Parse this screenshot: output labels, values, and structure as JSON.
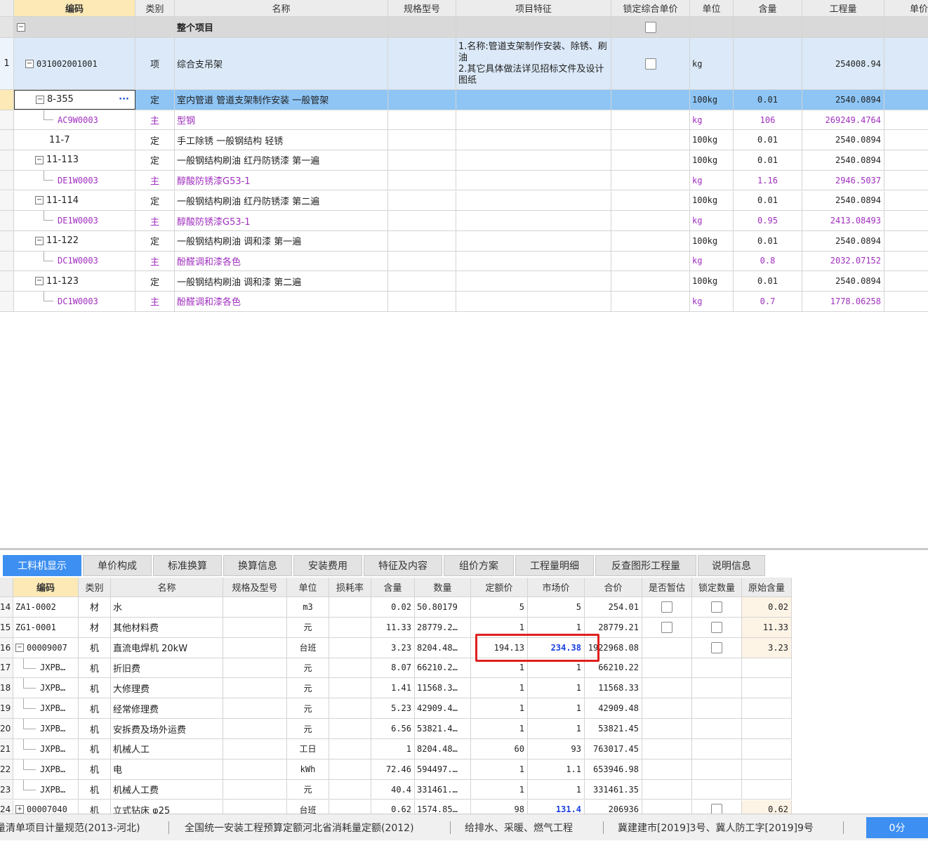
{
  "top_headers": [
    "编码",
    "类别",
    "名称",
    "规格型号",
    "项目特征",
    "锁定综合单价",
    "单位",
    "含量",
    "工程量",
    "单价"
  ],
  "whole_label": "整个项目",
  "item": {
    "rownum": "1",
    "code": "031002001001",
    "type": "项",
    "name": "综合支吊架",
    "feature": "1.名称:管道支架制作安装、除锈、刷油\n2.其它具体做法详见招标文件及设计图纸",
    "unit": "kg",
    "qty": "254008.94"
  },
  "sub_rows": [
    {
      "code": "8-355",
      "type": "定",
      "name": "室内管道 管道支架制作安装 一般管架",
      "unit": "100kg",
      "content": "0.01",
      "qty": "2540.0894"
    },
    {
      "code": "AC9W0003",
      "type": "主",
      "name": "型钢",
      "unit": "kg",
      "content": "106",
      "qty": "269249.4764"
    },
    {
      "code": "11-7",
      "type": "定",
      "name": "手工除锈 一般钢结构 轻锈",
      "unit": "100kg",
      "content": "0.01",
      "qty": "2540.0894"
    },
    {
      "code": "11-113",
      "type": "定",
      "name": "一般钢结构刷油 红丹防锈漆 第一遍",
      "unit": "100kg",
      "content": "0.01",
      "qty": "2540.0894"
    },
    {
      "code": "DE1W0003",
      "type": "主",
      "name": "醇酸防锈漆G53-1",
      "unit": "kg",
      "content": "1.16",
      "qty": "2946.5037"
    },
    {
      "code": "11-114",
      "type": "定",
      "name": "一般钢结构刷油 红丹防锈漆 第二遍",
      "unit": "100kg",
      "content": "0.01",
      "qty": "2540.0894"
    },
    {
      "code": "DE1W0003",
      "type": "主",
      "name": "醇酸防锈漆G53-1",
      "unit": "kg",
      "content": "0.95",
      "qty": "2413.08493"
    },
    {
      "code": "11-122",
      "type": "定",
      "name": "一般钢结构刷油 调和漆 第一遍",
      "unit": "100kg",
      "content": "0.01",
      "qty": "2540.0894"
    },
    {
      "code": "DC1W0003",
      "type": "主",
      "name": "酚醛调和漆各色",
      "unit": "kg",
      "content": "0.8",
      "qty": "2032.07152"
    },
    {
      "code": "11-123",
      "type": "定",
      "name": "一般钢结构刷油 调和漆 第二遍",
      "unit": "100kg",
      "content": "0.01",
      "qty": "2540.0894"
    },
    {
      "code": "DC1W0003",
      "type": "主",
      "name": "酚醛调和漆各色",
      "unit": "kg",
      "content": "0.7",
      "qty": "1778.06258"
    }
  ],
  "tabs": [
    "工料机显示",
    "单价构成",
    "标准换算",
    "换算信息",
    "安装费用",
    "特征及内容",
    "组价方案",
    "工程量明细",
    "反查图形工程量",
    "说明信息"
  ],
  "bottom_headers": [
    "编码",
    "类别",
    "名称",
    "规格及型号",
    "单位",
    "损耗率",
    "含量",
    "数量",
    "定额价",
    "市场价",
    "合价",
    "是否暂估",
    "锁定数量",
    "原始含量"
  ],
  "bottom_rows": [
    {
      "n": "14",
      "code": "ZA1-0002",
      "type": "材",
      "name": "水",
      "unit": "m3",
      "content": "0.02",
      "num": "50.80179",
      "quota": "5",
      "market": "5",
      "total": "254.01",
      "orig": "0.02"
    },
    {
      "n": "15",
      "code": "ZG1-0001",
      "type": "材",
      "name": "其他材料费",
      "unit": "元",
      "content": "11.33",
      "num": "28779.2…",
      "quota": "1",
      "market": "1",
      "total": "28779.21",
      "orig": "11.33"
    },
    {
      "n": "16",
      "code": "00009007",
      "type": "机",
      "name": "直流电焊机 20kW",
      "unit": "台班",
      "content": "3.23",
      "num": "8204.48…",
      "quota": "194.13",
      "market": "234.38",
      "total": "1922968.08",
      "orig": "3.23"
    },
    {
      "n": "17",
      "code": "JXPB…",
      "type": "机",
      "name": "折旧费",
      "unit": "元",
      "content": "8.07",
      "num": "66210.2…",
      "quota": "1",
      "market": "1",
      "total": "66210.22",
      "orig": ""
    },
    {
      "n": "18",
      "code": "JXPB…",
      "type": "机",
      "name": "大修理费",
      "unit": "元",
      "content": "1.41",
      "num": "11568.3…",
      "quota": "1",
      "market": "1",
      "total": "11568.33",
      "orig": ""
    },
    {
      "n": "19",
      "code": "JXPB…",
      "type": "机",
      "name": "经常修理费",
      "unit": "元",
      "content": "5.23",
      "num": "42909.4…",
      "quota": "1",
      "market": "1",
      "total": "42909.48",
      "orig": ""
    },
    {
      "n": "20",
      "code": "JXPB…",
      "type": "机",
      "name": "安拆费及场外运费",
      "unit": "元",
      "content": "6.56",
      "num": "53821.4…",
      "quota": "1",
      "market": "1",
      "total": "53821.45",
      "orig": ""
    },
    {
      "n": "21",
      "code": "JXPB…",
      "type": "机",
      "name": "机械人工",
      "unit": "工日",
      "content": "1",
      "num": "8204.48…",
      "quota": "60",
      "market": "93",
      "total": "763017.45",
      "orig": ""
    },
    {
      "n": "22",
      "code": "JXPB…",
      "type": "机",
      "name": "电",
      "unit": "kWh",
      "content": "72.46",
      "num": "594497.…",
      "quota": "1",
      "market": "1.1",
      "total": "653946.98",
      "orig": ""
    },
    {
      "n": "23",
      "code": "JXPB…",
      "type": "机",
      "name": "机械人工费",
      "unit": "元",
      "content": "40.4",
      "num": "331461.…",
      "quota": "1",
      "market": "1",
      "total": "331461.35",
      "orig": ""
    },
    {
      "n": "24",
      "code": "00007040",
      "type": "机",
      "name": "立式钻床 φ25",
      "unit": "台班",
      "content": "0.62",
      "num": "1574.85…",
      "quota": "98",
      "market": "131.4",
      "total": "206936",
      "orig": "0.62"
    }
  ],
  "status": [
    "量清单项目计量规范(2013-河北)",
    "全国统一安装工程预算定额河北省消耗量定额(2012)",
    "给排水、采暖、燃气工程",
    "冀建建市[2019]3号、冀人防工字[2019]9号"
  ],
  "score": "0分",
  "colors": {
    "selected_row": "#8ec5f5",
    "item_row": "#dbe9f8",
    "whole_row": "#d9d9d9",
    "purple": "#a12fbf",
    "tab_active": "#3d8ff1",
    "highlight": "#e02020"
  }
}
